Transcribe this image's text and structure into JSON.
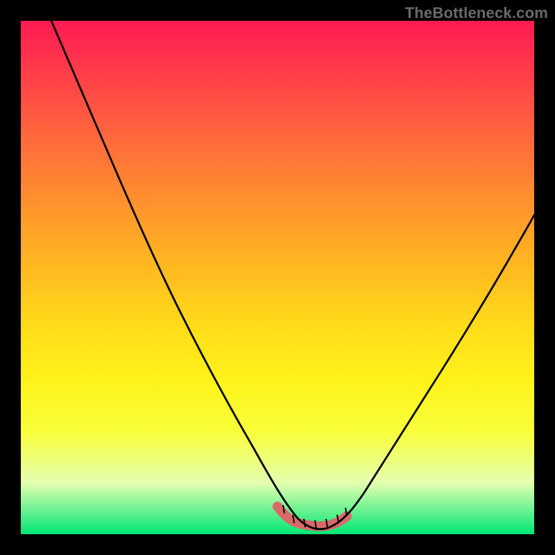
{
  "watermark": "TheBottleneck.com",
  "chart_data": {
    "type": "line",
    "title": "",
    "xlabel": "",
    "ylabel": "",
    "xlim": [
      0,
      100
    ],
    "ylim": [
      0,
      100
    ],
    "grid": false,
    "legend": false,
    "background": {
      "type": "vertical_gradient",
      "stops": [
        {
          "pos": 0.0,
          "color": "#ff1a53"
        },
        {
          "pos": 0.1,
          "color": "#ff3d4a"
        },
        {
          "pos": 0.2,
          "color": "#ff5f3f"
        },
        {
          "pos": 0.3,
          "color": "#ff8033"
        },
        {
          "pos": 0.4,
          "color": "#ffa028"
        },
        {
          "pos": 0.5,
          "color": "#ffbf1f"
        },
        {
          "pos": 0.6,
          "color": "#ffdd19"
        },
        {
          "pos": 0.7,
          "color": "#fff21a"
        },
        {
          "pos": 0.8,
          "color": "#f8ff3a"
        },
        {
          "pos": 0.9,
          "color": "#e4ffb0"
        },
        {
          "pos": 1.0,
          "color": "#00e676"
        }
      ]
    },
    "series": [
      {
        "name": "bottleneck_curve",
        "color": "#000000",
        "x": [
          6,
          10,
          15,
          20,
          25,
          30,
          35,
          40,
          45,
          50,
          52,
          55,
          58,
          60,
          63,
          65,
          70,
          75,
          80,
          85,
          90,
          95,
          100
        ],
        "y": [
          100,
          92,
          82,
          72,
          62,
          53,
          43,
          33,
          23,
          12,
          8,
          4,
          2,
          2,
          3,
          5,
          10,
          17,
          25,
          33,
          42,
          51,
          60
        ]
      },
      {
        "name": "optimal_zone",
        "color": "#d86a6a",
        "x": [
          50,
          52,
          55,
          58,
          60,
          62,
          64
        ],
        "y": [
          5,
          3,
          2,
          2,
          2,
          3,
          4
        ]
      }
    ],
    "notes": "Values estimated from pixel positions; chart has no visible axis ticks or numeric labels. x and y are normalized 0–100 across the plotting rectangle. y=0 at bottom (green), y=100 at top (red). Optimal-zone series is the thick salmon highlight near the curve minimum."
  }
}
